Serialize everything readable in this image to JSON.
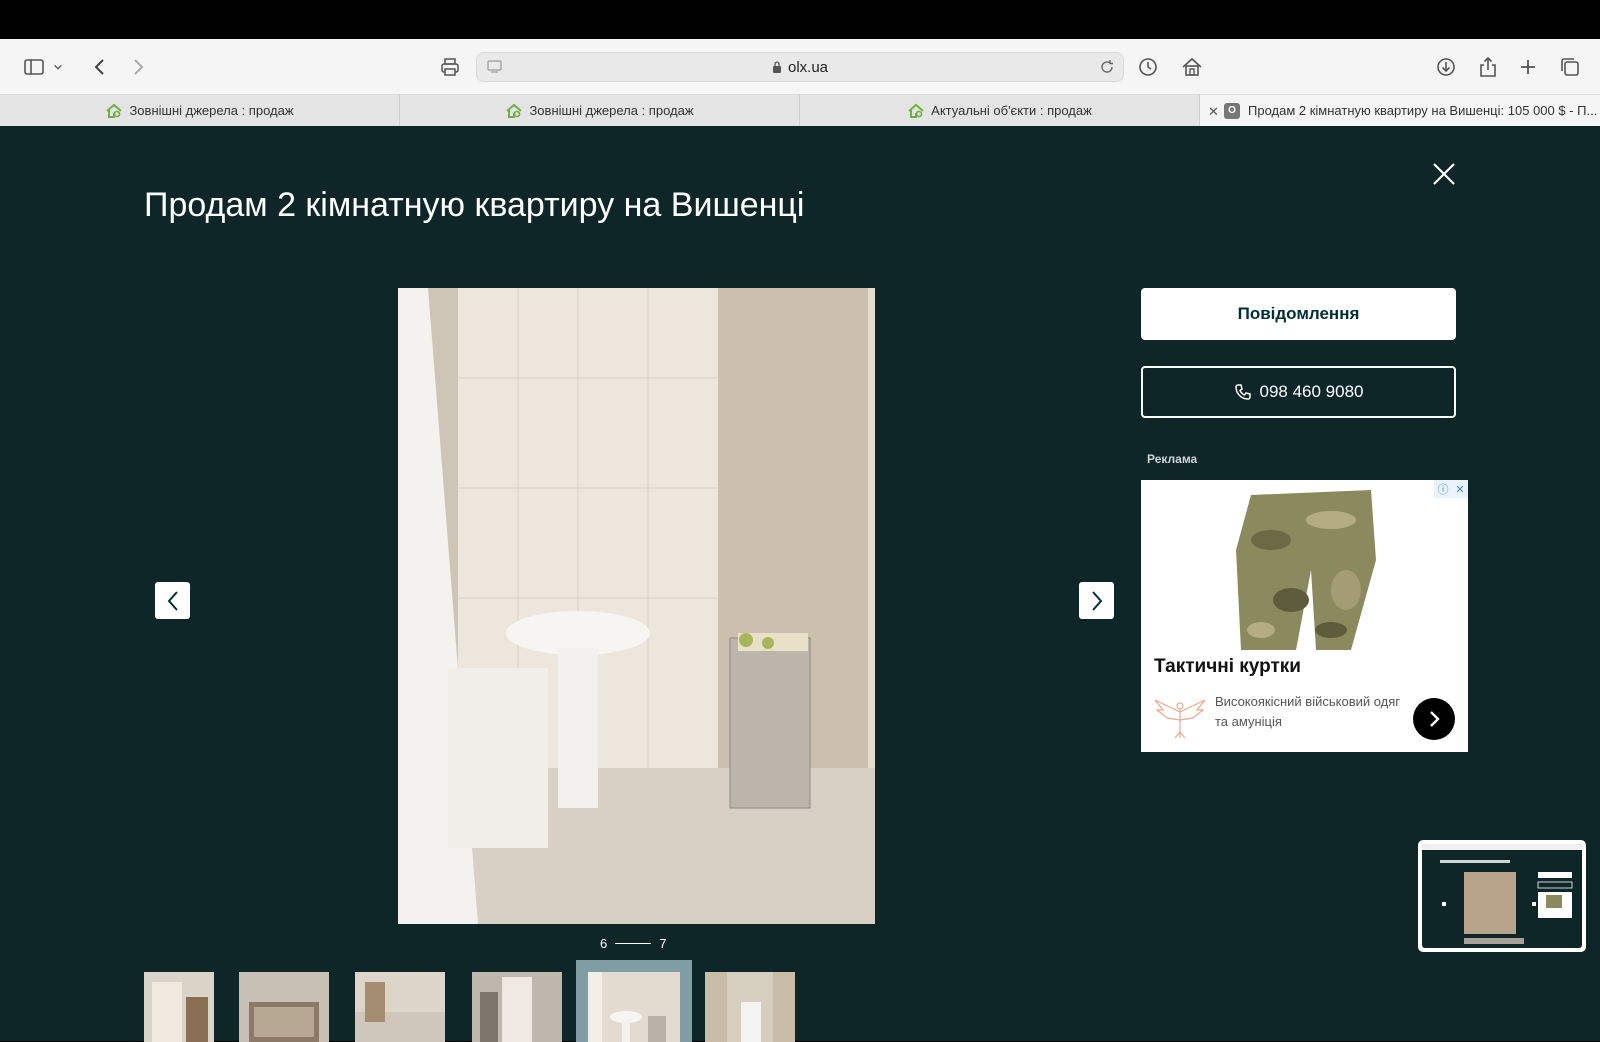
{
  "browser": {
    "url": "olx.ua",
    "tabs": [
      {
        "label": "Зовнішні джерела : продаж",
        "icon": "house-favicon"
      },
      {
        "label": "Зовнішні джерела : продаж",
        "icon": "house-favicon"
      },
      {
        "label": "Актуальні об'єкти : продаж",
        "icon": "house-favicon"
      },
      {
        "label": "Продам 2 кімнатную квартиру на Вишенці: 105 000 $ - П...",
        "icon": "olx-favicon",
        "favicon_letter": "O",
        "active": true
      }
    ]
  },
  "viewer": {
    "title": "Продам 2 кімнатную квартиру на Вишенці",
    "counter": {
      "current": "6",
      "total": "7"
    },
    "message_button": "Повідомлення",
    "phone": "098 460 9080"
  },
  "ad": {
    "label": "Реклама",
    "title": "Тактичні куртки",
    "description": "Високоякісний військовий одяг та амуніція"
  },
  "colors": {
    "viewer_bg": "#0f2628",
    "brand_dark": "#002f34",
    "selected_thumb": "#7f9da3",
    "favicon_green": "#6cb33f"
  }
}
